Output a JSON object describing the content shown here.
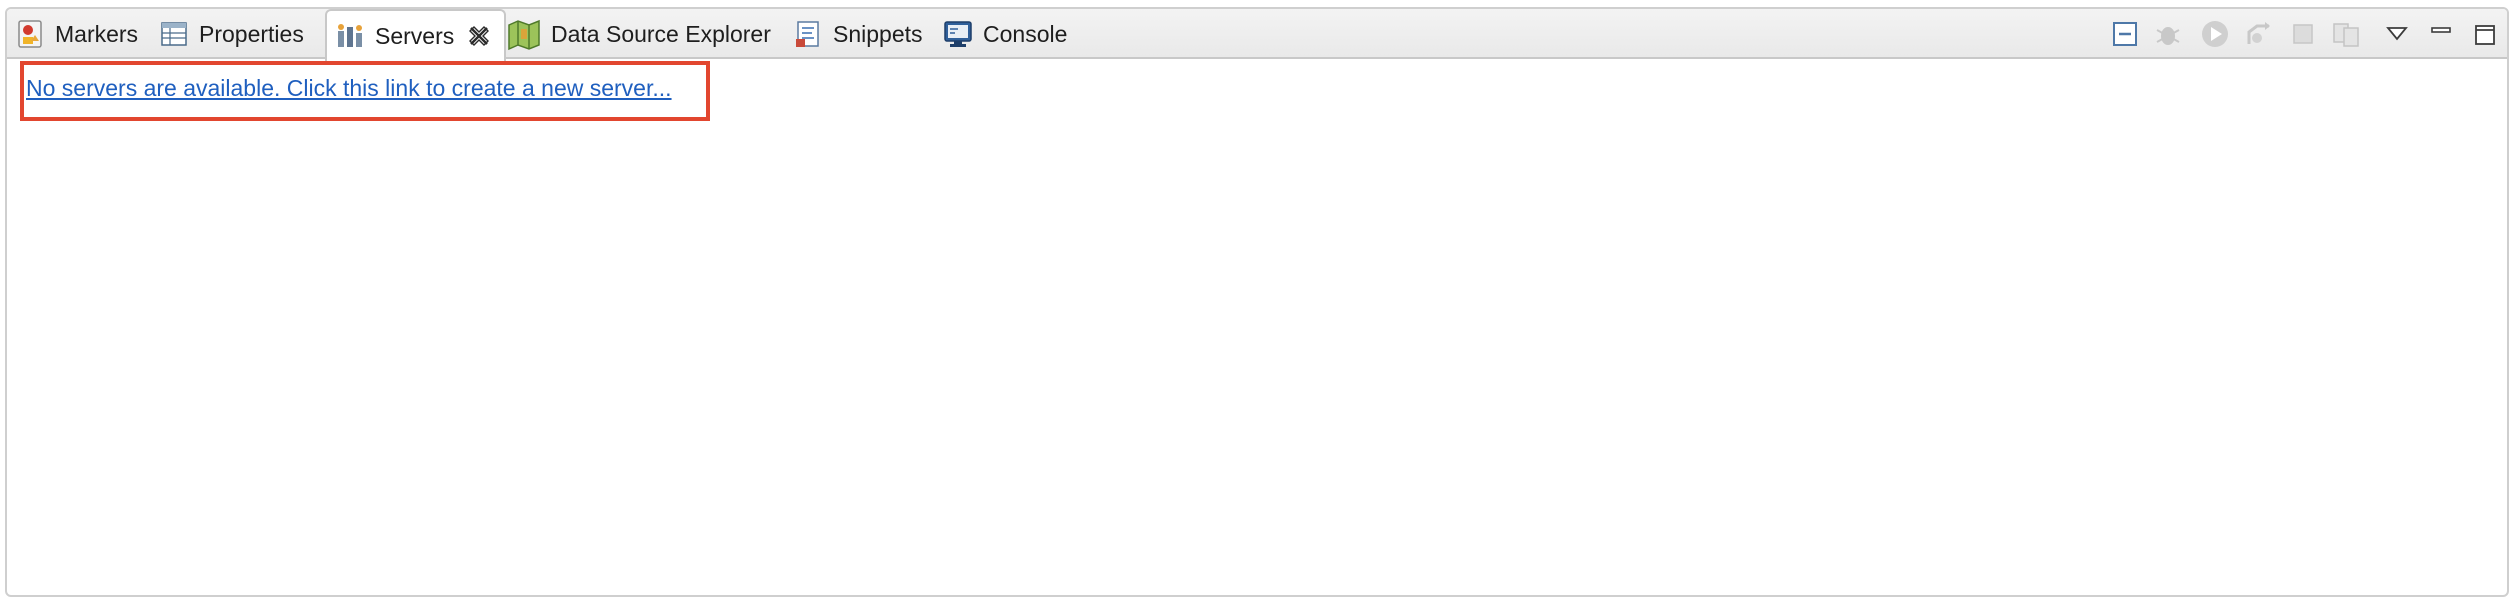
{
  "tabs": [
    {
      "label": "Markers",
      "icon": "markers-icon"
    },
    {
      "label": "Properties",
      "icon": "properties-icon"
    },
    {
      "label": "Servers",
      "icon": "servers-icon",
      "active": true
    },
    {
      "label": "Data Source Explorer",
      "icon": "data-source-explorer-icon"
    },
    {
      "label": "Snippets",
      "icon": "snippets-icon"
    },
    {
      "label": "Console",
      "icon": "console-icon"
    }
  ],
  "toolbar": {
    "icons": [
      "collapse-all-icon",
      "debug-server-icon",
      "start-server-icon",
      "restart-server-icon",
      "stop-server-icon",
      "publish-icon",
      "view-menu-icon",
      "minimize-icon",
      "maximize-icon"
    ]
  },
  "content": {
    "create_server_link": "No servers are available. Click this link to create a new server..."
  },
  "colors": {
    "link": "#1f5fbf",
    "highlight": "#e2462f",
    "tab_bar": "#ececec"
  }
}
